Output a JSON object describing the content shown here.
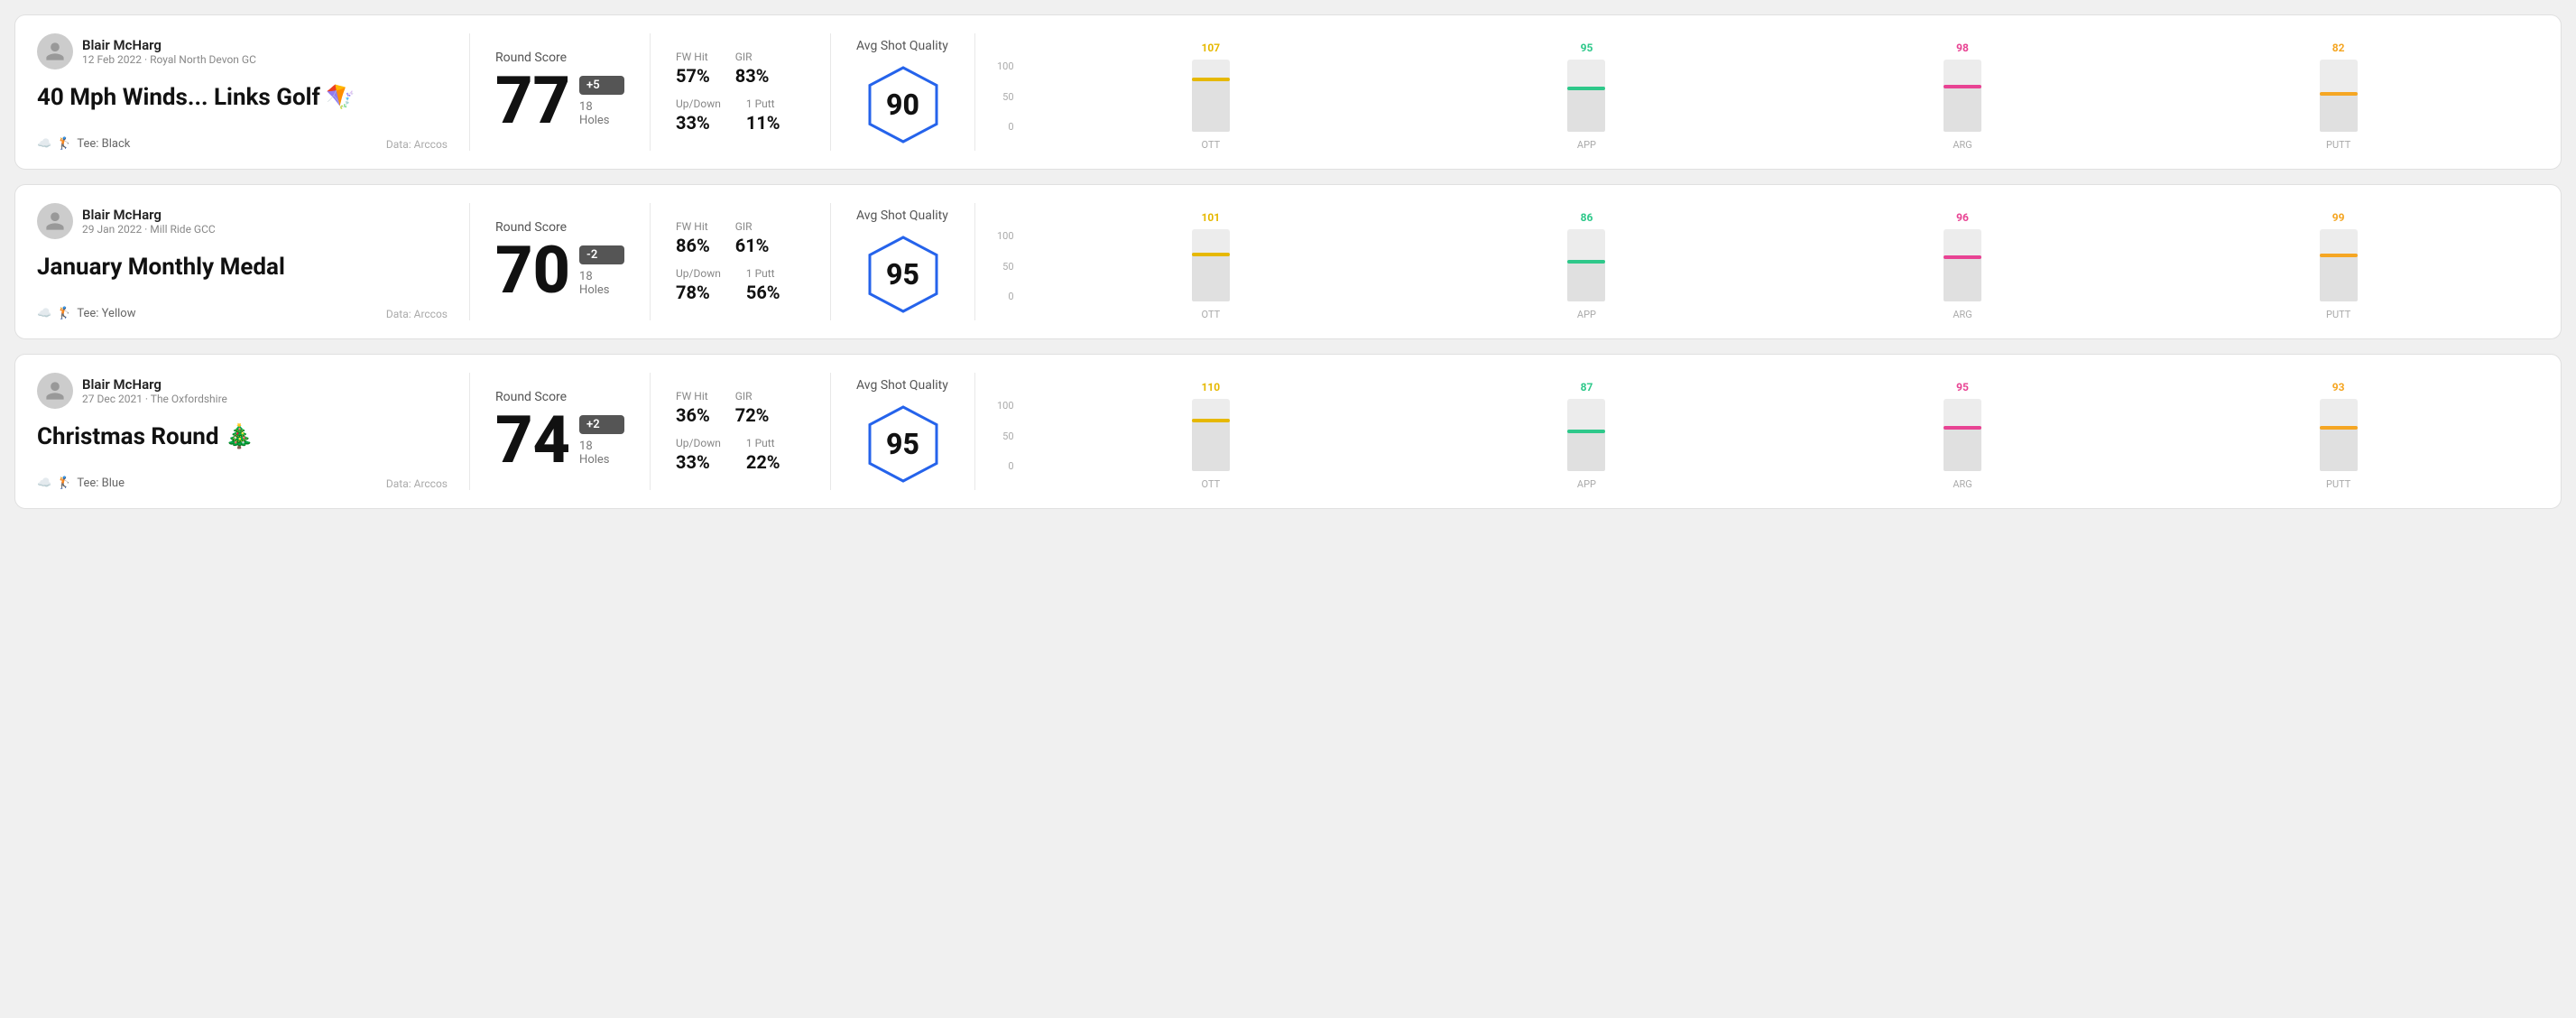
{
  "rounds": [
    {
      "id": "round1",
      "user": {
        "name": "Blair McHarg",
        "meta": "12 Feb 2022 · Royal North Devon GC"
      },
      "title": "40 Mph Winds... Links Golf 🪁",
      "tee": "Black",
      "data_source": "Data: Arccos",
      "score": "77",
      "score_badge": "+5",
      "score_badge_type": "over",
      "holes": "18 Holes",
      "fw_hit": "57%",
      "gir": "83%",
      "up_down": "33%",
      "one_putt": "11%",
      "avg_shot_quality": "90",
      "chart": {
        "bars": [
          {
            "label": "OTT",
            "value": 107,
            "max": 120,
            "color_class": "color-ott",
            "line_class": "line-ott",
            "pct": 75
          },
          {
            "label": "APP",
            "value": 95,
            "max": 120,
            "color_class": "color-app",
            "line_class": "line-app",
            "pct": 62
          },
          {
            "label": "ARG",
            "value": 98,
            "max": 120,
            "color_class": "color-arg",
            "line_class": "line-arg",
            "pct": 65
          },
          {
            "label": "PUTT",
            "value": 82,
            "max": 120,
            "color_class": "color-putt",
            "line_class": "line-putt",
            "pct": 55
          }
        ]
      }
    },
    {
      "id": "round2",
      "user": {
        "name": "Blair McHarg",
        "meta": "29 Jan 2022 · Mill Ride GCC"
      },
      "title": "January Monthly Medal",
      "tee": "Yellow",
      "data_source": "Data: Arccos",
      "score": "70",
      "score_badge": "-2",
      "score_badge_type": "under",
      "holes": "18 Holes",
      "fw_hit": "86%",
      "gir": "61%",
      "up_down": "78%",
      "one_putt": "56%",
      "avg_shot_quality": "95",
      "chart": {
        "bars": [
          {
            "label": "OTT",
            "value": 101,
            "max": 120,
            "color_class": "color-ott",
            "line_class": "line-ott",
            "pct": 68
          },
          {
            "label": "APP",
            "value": 86,
            "max": 120,
            "color_class": "color-app",
            "line_class": "line-app",
            "pct": 57
          },
          {
            "label": "ARG",
            "value": 96,
            "max": 120,
            "color_class": "color-arg",
            "line_class": "line-arg",
            "pct": 64
          },
          {
            "label": "PUTT",
            "value": 99,
            "max": 120,
            "color_class": "color-putt",
            "line_class": "line-putt",
            "pct": 66
          }
        ]
      }
    },
    {
      "id": "round3",
      "user": {
        "name": "Blair McHarg",
        "meta": "27 Dec 2021 · The Oxfordshire"
      },
      "title": "Christmas Round 🎄",
      "tee": "Blue",
      "data_source": "Data: Arccos",
      "score": "74",
      "score_badge": "+2",
      "score_badge_type": "over",
      "holes": "18 Holes",
      "fw_hit": "36%",
      "gir": "72%",
      "up_down": "33%",
      "one_putt": "22%",
      "avg_shot_quality": "95",
      "chart": {
        "bars": [
          {
            "label": "OTT",
            "value": 110,
            "max": 120,
            "color_class": "color-ott",
            "line_class": "line-ott",
            "pct": 73
          },
          {
            "label": "APP",
            "value": 87,
            "max": 120,
            "color_class": "color-app",
            "line_class": "line-app",
            "pct": 58
          },
          {
            "label": "ARG",
            "value": 95,
            "max": 120,
            "color_class": "color-arg",
            "line_class": "line-arg",
            "pct": 63
          },
          {
            "label": "PUTT",
            "value": 93,
            "max": 120,
            "color_class": "color-putt",
            "line_class": "line-putt",
            "pct": 62
          }
        ]
      }
    }
  ],
  "y_axis_labels": [
    "100",
    "50",
    "0"
  ],
  "labels": {
    "round_score": "Round Score",
    "fw_hit": "FW Hit",
    "gir": "GIR",
    "up_down": "Up/Down",
    "one_putt": "1 Putt",
    "avg_shot_quality": "Avg Shot Quality",
    "data_prefix": "Data: Arccos",
    "tee_prefix": "Tee:"
  }
}
